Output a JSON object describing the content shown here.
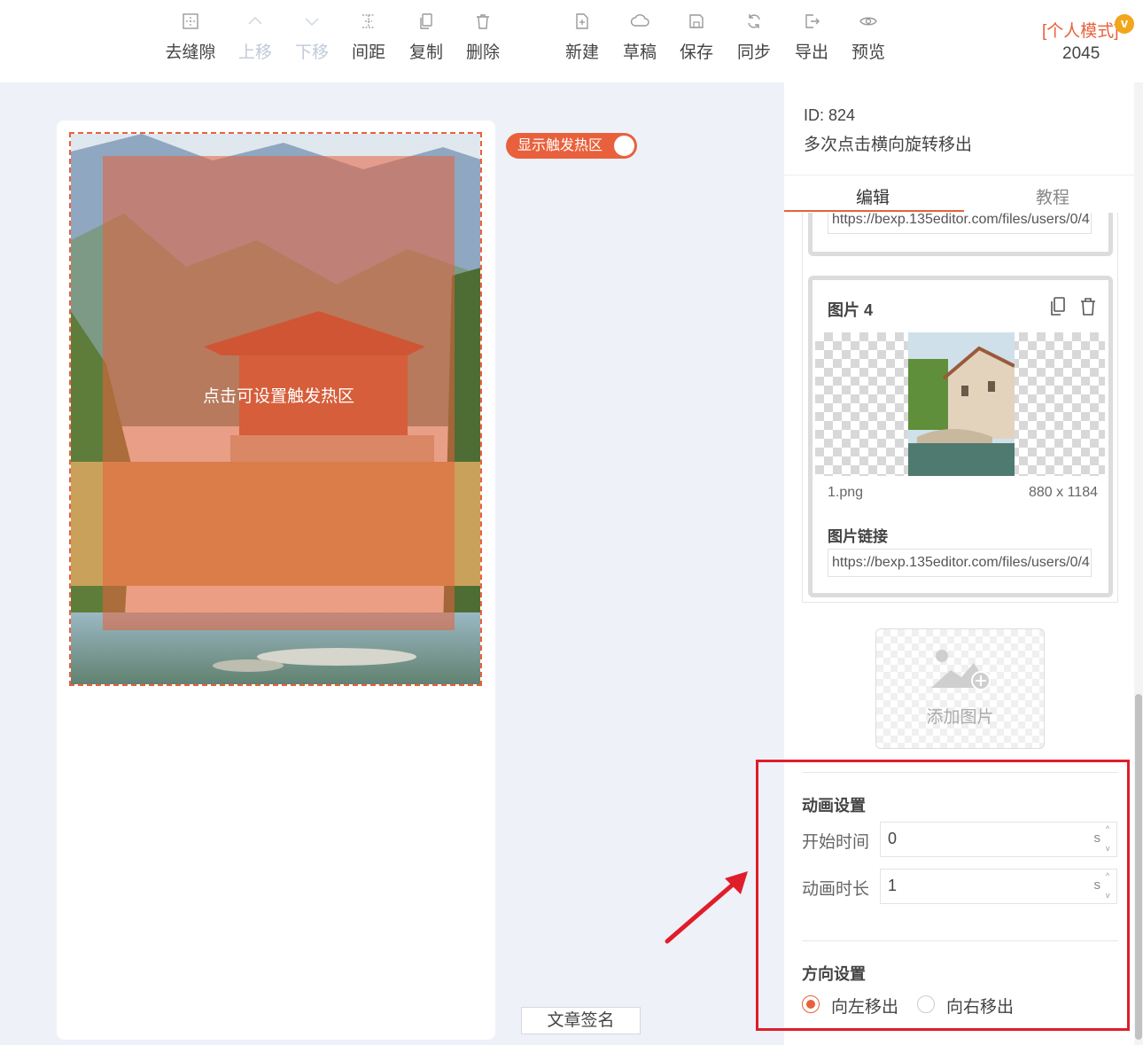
{
  "toolbar": {
    "tools": [
      {
        "label": "去缝隙",
        "icon": "remove-gap-icon",
        "enabled": true
      },
      {
        "label": "上移",
        "icon": "chevron-up-icon",
        "enabled": false
      },
      {
        "label": "下移",
        "icon": "chevron-down-icon",
        "enabled": false
      },
      {
        "label": "间距",
        "icon": "spacing-icon",
        "enabled": true
      },
      {
        "label": "复制",
        "icon": "copy-icon",
        "enabled": true
      },
      {
        "label": "删除",
        "icon": "trash-icon",
        "enabled": true
      },
      {
        "label": "新建",
        "icon": "new-file-icon",
        "enabled": true
      },
      {
        "label": "草稿",
        "icon": "cloud-icon",
        "enabled": true
      },
      {
        "label": "保存",
        "icon": "save-icon",
        "enabled": true
      },
      {
        "label": "同步",
        "icon": "sync-icon",
        "enabled": true
      },
      {
        "label": "导出",
        "icon": "export-icon",
        "enabled": true
      },
      {
        "label": "预览",
        "icon": "eye-icon",
        "enabled": true
      }
    ],
    "mode_label": "[个人模式]",
    "vip_badge": "v",
    "mode_number": "2045"
  },
  "canvas": {
    "hotzone_label": "点击可设置触发热区",
    "toggle_label": "显示触发热区",
    "toggle_on": true,
    "sign_button": "文章签名"
  },
  "panel": {
    "id_text": "ID: 824",
    "description": "多次点击横向旋转移出",
    "tabs": [
      {
        "label": "编辑",
        "active": true
      },
      {
        "label": "教程",
        "active": false
      }
    ],
    "prev_card_url": "https://bexp.135editor.com/files/users/0/4",
    "image_card": {
      "title": "图片 4",
      "filename": "1.png",
      "dimensions": "880 x 1184",
      "link_label": "图片链接",
      "link_value": "https://bexp.135editor.com/files/users/0/4"
    },
    "add_image_label": "添加图片",
    "animation": {
      "title": "动画设置",
      "start_label": "开始时间",
      "start_value": "0",
      "duration_label": "动画时长",
      "duration_value": "1",
      "unit": "s"
    },
    "direction": {
      "title": "方向设置",
      "options": [
        {
          "label": "向左移出",
          "checked": true
        },
        {
          "label": "向右移出",
          "checked": false
        }
      ]
    }
  },
  "colors": {
    "accent": "#e8613c",
    "highlight": "#e01d2a",
    "vip": "#f1a61b"
  }
}
